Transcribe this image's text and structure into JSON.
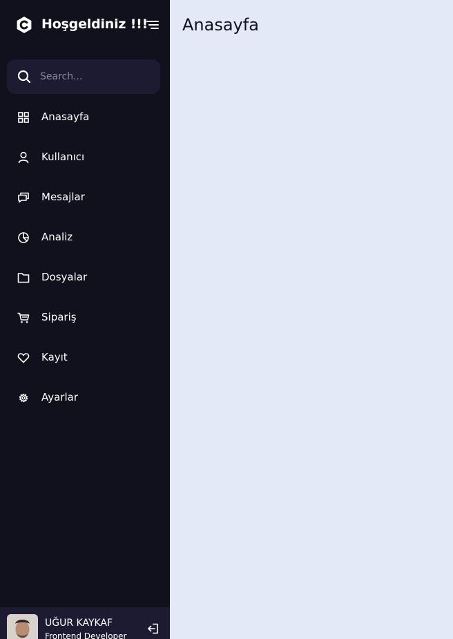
{
  "header": {
    "title": "Hoşgeldiniz !!!",
    "logo_icon": "c-hexagon-logo-icon",
    "toggle_icon": "menu-lines-icon"
  },
  "search": {
    "placeholder": "Search...",
    "value": "",
    "icon": "search-icon"
  },
  "sidebar": {
    "items": [
      {
        "label": "Anasayfa",
        "icon": "grid-icon"
      },
      {
        "label": "Kullanıcı",
        "icon": "user-icon"
      },
      {
        "label": "Mesajlar",
        "icon": "chat-icon"
      },
      {
        "label": "Analiz",
        "icon": "pie-chart-icon"
      },
      {
        "label": "Dosyalar",
        "icon": "folder-icon"
      },
      {
        "label": "Sipariş",
        "icon": "cart-icon"
      },
      {
        "label": "Kayıt",
        "icon": "heart-icon"
      },
      {
        "label": "Ayarlar",
        "icon": "gear-icon"
      }
    ]
  },
  "profile": {
    "name": "UĞUR KAYKAF",
    "job": "Frontend Developer",
    "logout_icon": "logout-icon"
  },
  "main": {
    "title": "Anasayfa"
  },
  "colors": {
    "sidebar_bg": "#11101d",
    "search_bg": "#1d1b31",
    "main_bg": "#e4e9f7",
    "text_light": "#ffffff",
    "text_dark": "#11101d"
  }
}
